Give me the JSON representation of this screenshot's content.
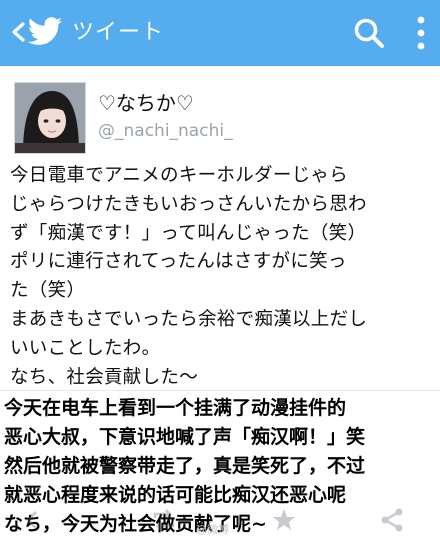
{
  "header": {
    "title": "ツイート",
    "bar_color": "#55acee",
    "back_icon": "chevron-left-icon",
    "logo_icon": "twitter-bird-icon",
    "search_icon": "search-icon",
    "menu_icon": "more-vertical-icon"
  },
  "profile": {
    "display_name": "♡なちか♡",
    "handle": "@_nachi_nachi_",
    "avatar_icon": "avatar"
  },
  "tweet": {
    "lines": [
      "今日電車でアニメのキーホルダーじゃら",
      "じゃらつけたきもいおっさんいたから思わ",
      "ず「痴漢です！」って叫んじゃった（笑）",
      "ポリに連行されてったんはさすがに笑っ",
      "た（笑）",
      "まあきもさでいったら余裕で痴漢以上だし",
      "いいことしたわ。",
      "なち、社会貢献した〜"
    ]
  },
  "caption": {
    "lines": [
      "今天在电车上看到一个挂满了动漫挂件的",
      "恶心大叔，下意识地喊了声「痴汉啊！」笑",
      "然后他就被警察带走了，真是笑死了，不过",
      "就恶心程度来说的话可能比痴汉还恶心呢",
      "なち，今天为社会做贡献了呢~"
    ]
  },
  "actions": {
    "icons": [
      "reply-icon",
      "retweet-icon",
      "favorite-icon",
      "share-icon"
    ]
  },
  "watermark": {
    "text": "@微博"
  }
}
